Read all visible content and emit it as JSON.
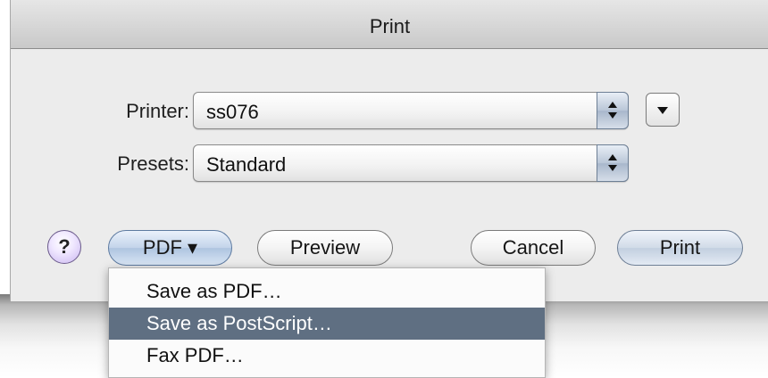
{
  "window": {
    "title": "Print"
  },
  "printer": {
    "label": "Printer:",
    "value": "ss076"
  },
  "presets": {
    "label": "Presets:",
    "value": "Standard"
  },
  "buttons": {
    "help": "?",
    "pdf": "PDF ▾",
    "preview": "Preview",
    "cancel": "Cancel",
    "print": "Print"
  },
  "pdf_menu": {
    "items": [
      {
        "label": "Save as PDF…"
      },
      {
        "label": "Save as PostScript…"
      },
      {
        "label": "Fax PDF…"
      }
    ],
    "selected_index": 1
  },
  "colors": {
    "menu_highlight": "#5f6f82",
    "dialog_background": "#ececec"
  }
}
